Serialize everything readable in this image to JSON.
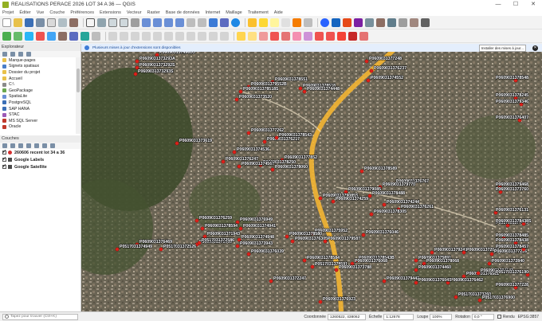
{
  "window": {
    "title": "REALISATIONS PERACE 2026 LOT 34 A 36 — QGIS",
    "controls": [
      "—",
      "☐",
      "✕"
    ]
  },
  "menu": [
    "Projet",
    "Éditer",
    "Vue",
    "Couche",
    "Préférences",
    "Extensions",
    "Vecteur",
    "Raster",
    "Base de données",
    "Internet",
    "Maillage",
    "Traitement",
    "Aide"
  ],
  "message_bar": {
    "text": "Plusieurs mises à jour d'extensions sont disponibles",
    "button": "Installer des mises à jour..."
  },
  "explorer": {
    "title": "Explorateur",
    "items": [
      {
        "label": "Marque-pages",
        "color": "#e8c14a"
      },
      {
        "label": "Signets spatiaux",
        "color": "#4a7ec9"
      },
      {
        "label": "Dossier du projet",
        "color": "#e8c14a"
      },
      {
        "label": "Accueil",
        "color": "#e8c14a"
      },
      {
        "label": "C:\\",
        "color": "#8a8a8a"
      },
      {
        "label": "GeoPackage",
        "color": "#6aa84f"
      },
      {
        "label": "SpatiaLite",
        "color": "#6a8fd6"
      },
      {
        "label": "PostgreSQL",
        "color": "#3b6fb6"
      },
      {
        "label": "SAP HANA",
        "color": "#3b6fb6"
      },
      {
        "label": "STAC",
        "color": "#9b59b6"
      },
      {
        "label": "MS SQL Server",
        "color": "#c0392b"
      },
      {
        "label": "Oracle",
        "color": "#c0392b"
      }
    ]
  },
  "layers": {
    "title": "Couches",
    "items": [
      {
        "label": "260606 recent lot 34 a 36",
        "symbol": "#d32f2f"
      },
      {
        "label": "Google Labels",
        "symbol": "#4a4a4a"
      },
      {
        "label": "Google Satellite",
        "symbol": "#4a4a4a"
      }
    ]
  },
  "map_points": [
    {
      "label": "P0609031374961O"
    },
    {
      "label": "P0609031373293A"
    },
    {
      "label": "P0609031373292S"
    },
    {
      "label": "P0609031373293S"
    },
    {
      "label": "P0609031378551"
    },
    {
      "label": "P0609031379552B"
    },
    {
      "label": "P0609031378518"
    },
    {
      "label": "P0609031378518S"
    },
    {
      "label": "P0609031374448"
    },
    {
      "label": "P0609031373520"
    },
    {
      "label": "P0609031377248"
    },
    {
      "label": "P0609031376237"
    },
    {
      "label": "P0609031374552"
    },
    {
      "label": "P0609031378548"
    },
    {
      "label": "P0609031378245"
    },
    {
      "label": "P0609031376407"
    },
    {
      "label": "P0609031379346"
    },
    {
      "label": "P0609031373619"
    },
    {
      "label": "P0609031377262"
    },
    {
      "label": "P0609031376217"
    },
    {
      "label": "P0609031378543"
    },
    {
      "label": "P0609031374536"
    },
    {
      "label": "P0609031376247"
    },
    {
      "label": "P0609031377852"
    },
    {
      "label": "P0609031378250"
    },
    {
      "label": "P0609031374567"
    },
    {
      "label": "P0609031378060"
    },
    {
      "label": "P0609031378589"
    },
    {
      "label": "P0609031376767"
    },
    {
      "label": "P0609031379770"
    },
    {
      "label": "P0609031379085"
    },
    {
      "label": "P0609031378488"
    },
    {
      "label": "P0609031379468"
    },
    {
      "label": "P0609031379085S"
    },
    {
      "label": "P0609031374259"
    },
    {
      "label": "P0609031374244"
    },
    {
      "label": "P0609031376261"
    },
    {
      "label": "P0609031373760"
    },
    {
      "label": "P0609031378305"
    },
    {
      "label": "P0609031376131"
    },
    {
      "label": "P0609031376259"
    },
    {
      "label": "P0609031376949"
    },
    {
      "label": "P0609031378594"
    },
    {
      "label": "P0609031374941"
    },
    {
      "label": "P0609031371943"
    },
    {
      "label": "P0609031374948"
    },
    {
      "label": "P0609031373960"
    },
    {
      "label": "P0609031373943"
    },
    {
      "label": "P0609031375952"
    },
    {
      "label": "P0609031376046"
    },
    {
      "label": "P0609031378580"
    },
    {
      "label": "P0609031376305"
    },
    {
      "label": "P0609031376469"
    },
    {
      "label": "P0517031372586"
    },
    {
      "label": "P0609031379587"
    },
    {
      "label": "P0517031374949"
    },
    {
      "label": "P0517031372526"
    },
    {
      "label": "P0609031376039"
    },
    {
      "label": "P0609031378584"
    },
    {
      "label": "P0609031378543B"
    },
    {
      "label": "P0609031375891"
    },
    {
      "label": "P0609031379247"
    },
    {
      "label": "P0609031372047"
    },
    {
      "label": "P0517031378591"
    },
    {
      "label": "P0609031376068"
    },
    {
      "label": "P0609031378068"
    },
    {
      "label": "P0609031377226"
    },
    {
      "label": "P0609031373788"
    },
    {
      "label": "P0609031374460"
    },
    {
      "label": "P0609031376581"
    },
    {
      "label": "P0517031373260"
    },
    {
      "label": "P0609031372247"
    },
    {
      "label": "P0609031379442"
    },
    {
      "label": "P0609031376462"
    },
    {
      "label": "P0609031384143"
    },
    {
      "label": "P0609031372840"
    },
    {
      "label": "P0517031377869"
    },
    {
      "label": "P0609031376047"
    },
    {
      "label": "P0609031376923"
    },
    {
      "label": "P0517031376190"
    },
    {
      "label": "P0609031378485"
    },
    {
      "label": "P0609031378438"
    },
    {
      "label": "P0609031378457"
    },
    {
      "label": "P0517031376900"
    },
    {
      "label": "P0609031377228"
    },
    {
      "label": "P0609031378438S"
    }
  ],
  "status": {
    "search_placeholder": "Tapez pour trouver (Ctrl+K)",
    "coord_label": "Coordonnée",
    "coord_value": "1260522, 438062",
    "scale_label": "Échelle",
    "scale_value": "1:12678",
    "magnifier_label": "Loupe",
    "magnifier_value": "100%",
    "rotation_label": "Rotation",
    "rotation_value": "0,0 °",
    "render_label": "Rendu",
    "crs": "EPSG:3857"
  }
}
